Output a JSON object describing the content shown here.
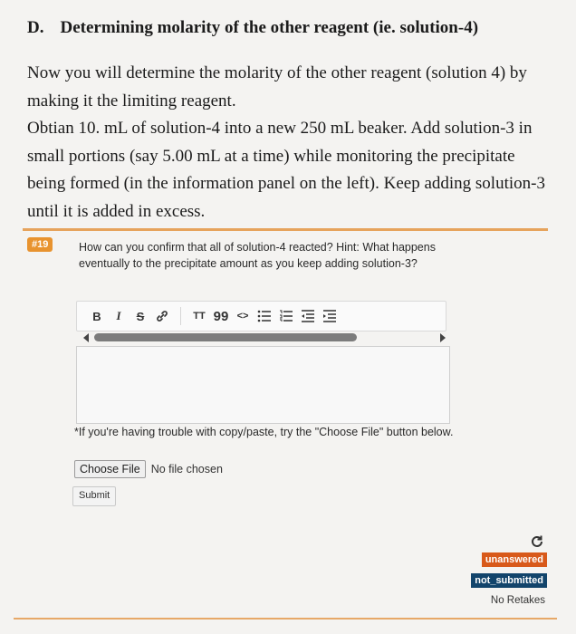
{
  "section": {
    "letter": "D.",
    "title": "Determining molarity of the other reagent (ie. solution-4)"
  },
  "instructions": {
    "para1": "Now you will determine the molarity of the other reagent (solution 4) by making it the limiting reagent.",
    "para2": "Obtian 10. mL of solution-4 into a new 250 mL beaker. Add solution-3 in small portions (say 5.00 mL at a time) while monitoring the precipitate being formed (in the information panel on the left). Keep adding solution-3 until it is added in excess."
  },
  "question": {
    "number": "#19",
    "text": "How can you confirm that all of solution-4 reacted? Hint: What happens eventually to the precipitate amount as you keep adding solution-3?"
  },
  "toolbar": {
    "bold": "B",
    "italic": "I",
    "strike": "S",
    "title": "TT",
    "quote": "99",
    "code": "<>",
    "icons": [
      "bold-icon",
      "italic-icon",
      "strikethrough-icon",
      "link-icon",
      "heading-icon",
      "quote-icon",
      "code-icon",
      "bullet-list-icon",
      "numbered-list-icon",
      "outdent-icon",
      "indent-icon"
    ]
  },
  "editor": {
    "value": ""
  },
  "note": "*If you're having trouble with copy/paste, try the \"Choose File\" button below.",
  "file_input": {
    "button_label": "Choose File",
    "status": "No file chosen"
  },
  "submit_label": "Submit",
  "status": {
    "answer_badge": "unanswered",
    "submit_badge": "not_submitted",
    "retakes": "No Retakes"
  },
  "colors": {
    "accent_orange": "#e8932f",
    "unanswered": "#d8591a",
    "not_submitted": "#12446b"
  }
}
